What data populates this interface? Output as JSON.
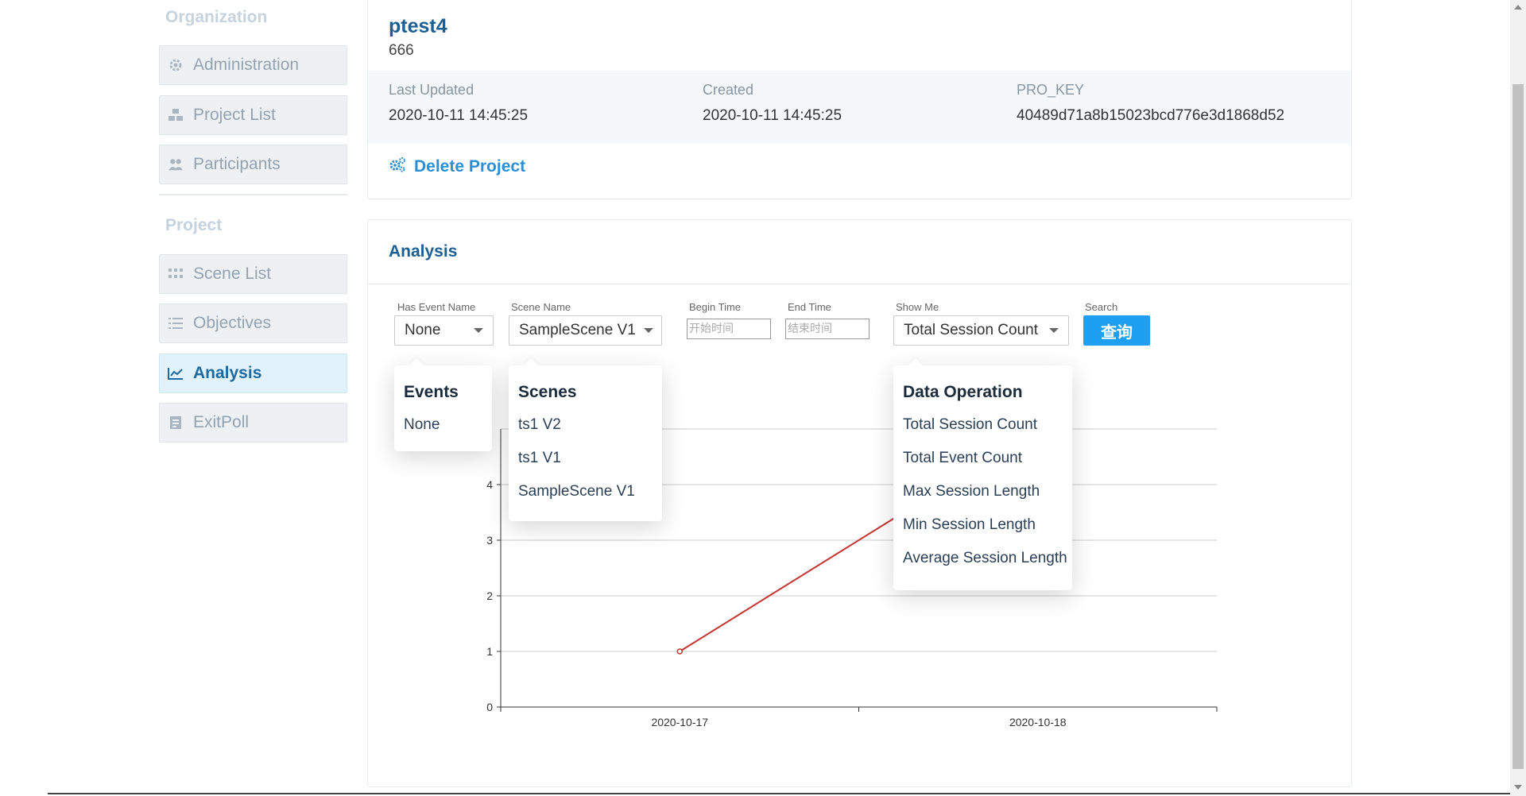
{
  "sidebar": {
    "organization_title": "Organization",
    "project_title": "Project",
    "org_items": [
      {
        "label": "Administration",
        "icon": "gear-icon"
      },
      {
        "label": "Project List",
        "icon": "project-list-icon"
      },
      {
        "label": "Participants",
        "icon": "participants-icon"
      }
    ],
    "project_items": [
      {
        "label": "Scene List",
        "icon": "grid-icon"
      },
      {
        "label": "Objectives",
        "icon": "checklist-icon"
      },
      {
        "label": "Analysis",
        "icon": "chart-line-icon",
        "active": true
      },
      {
        "label": "ExitPoll",
        "icon": "document-icon"
      }
    ]
  },
  "project": {
    "name": "ptest4",
    "description": "666",
    "last_updated_label": "Last Updated",
    "last_updated": "2020-10-11 14:45:25",
    "created_label": "Created",
    "created": "2020-10-11 14:45:25",
    "pro_key_label": "PRO_KEY",
    "pro_key": "40489d71a8b15023bcd776e3d1868d52",
    "delete_label": "Delete Project"
  },
  "analysis": {
    "title": "Analysis",
    "filters": {
      "event_label": "Has Event Name",
      "event_value": "None",
      "scene_label": "Scene Name",
      "scene_value": "SampleScene V1",
      "begin_label": "Begin Time",
      "begin_placeholder": "开始时间",
      "end_label": "End Time",
      "end_placeholder": "结束时间",
      "show_label": "Show Me",
      "show_value": "Total Session Count",
      "search_label": "Search",
      "search_button": "查询"
    },
    "events_dropdown": {
      "title": "Events",
      "items": [
        "None"
      ]
    },
    "scenes_dropdown": {
      "title": "Scenes",
      "items": [
        "ts1 V2",
        "ts1 V1",
        "SampleScene V1"
      ]
    },
    "data_op_dropdown": {
      "title": "Data Operation",
      "items": [
        "Total Session Count",
        "Total Event Count",
        "Max Session Length",
        "Min Session Length",
        "Average Session Length"
      ]
    }
  },
  "chart_data": {
    "type": "line",
    "x": [
      "2020-10-17",
      "2020-10-18"
    ],
    "series": [
      {
        "values": [
          1,
          5
        ]
      }
    ],
    "ylim": [
      0,
      5
    ],
    "yticks": [
      0,
      1,
      2,
      3,
      4
    ],
    "grid": true,
    "colors": {
      "line": "#c23531",
      "grid": "#cccccc"
    }
  }
}
